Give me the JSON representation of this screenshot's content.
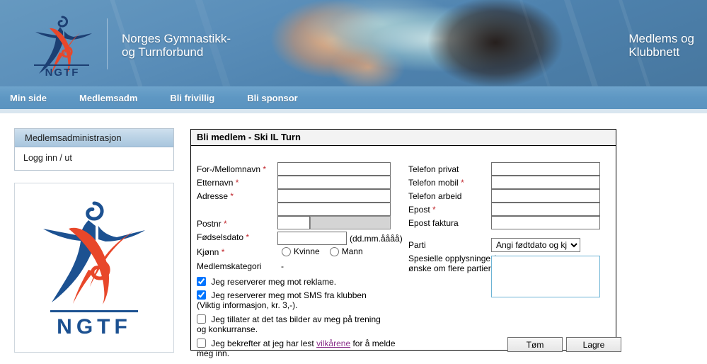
{
  "header": {
    "org_name_line1": "Norges Gymnastikk-",
    "org_name_line2": "og Turnforbund",
    "logo_word": "NGTF",
    "right_line1": "Medlems og",
    "right_line2": "Klubbnett",
    "banner_blue": "#5b8fba"
  },
  "nav": {
    "items": [
      {
        "label": "Min side"
      },
      {
        "label": "Medlemsadm"
      },
      {
        "label": "Bli frivillig"
      },
      {
        "label": "Bli sponsor"
      }
    ],
    "bar_color": "#5e97c3"
  },
  "sidebar": {
    "panel_title": "Medlemsadministrasjon",
    "links": [
      {
        "label": "Logg inn / ut"
      }
    ],
    "logo_word": "NGTF",
    "logo_blue": "#1c5191",
    "logo_red": "#e8472a"
  },
  "form": {
    "title_main": "Bli medlem",
    "title_sep": " - ",
    "title_club": "Ski IL Turn",
    "left_fields": [
      {
        "label": "For-/Mellomnavn",
        "required": true,
        "value": "",
        "placeholder": ""
      },
      {
        "label": "Etternavn",
        "required": true,
        "value": "",
        "placeholder": ""
      },
      {
        "label": "Adresse",
        "required": true,
        "value": "",
        "placeholder": ""
      }
    ],
    "address_line2": {
      "value": "",
      "placeholder": ""
    },
    "postnr": {
      "label": "Postnr",
      "required": true,
      "value": "",
      "city_value": "",
      "city_disabled": true
    },
    "fodselsdato": {
      "label": "Fødselsdato",
      "required": true,
      "value": "",
      "hint": "(dd.mm.åååå)"
    },
    "kjonn": {
      "label": "Kjønn",
      "required": true,
      "options": [
        {
          "label": "Kvinne",
          "checked": false
        },
        {
          "label": "Mann",
          "checked": false
        }
      ]
    },
    "medlemskategori": {
      "label": "Medlemskategori",
      "value": "-"
    },
    "right_fields": [
      {
        "label": "Telefon privat",
        "required": false,
        "value": ""
      },
      {
        "label": "Telefon mobil",
        "required": true,
        "value": ""
      },
      {
        "label": "Telefon arbeid",
        "required": false,
        "value": ""
      },
      {
        "label": "Epost",
        "required": true,
        "value": ""
      },
      {
        "label": "Epost faktura",
        "required": false,
        "value": ""
      }
    ],
    "parti": {
      "label": "Parti",
      "selected": "Angi fødtdato og kjønn",
      "options": [
        "Angi fødtdato og kjønn"
      ]
    },
    "spesielle": {
      "label_line1": "Spesielle opplysninger/",
      "label_line2": "ønske om flere partier",
      "value": "",
      "placeholder": ""
    },
    "checkboxes": [
      {
        "checked": true,
        "text": "Jeg reserverer meg mot reklame.",
        "link_text": null
      },
      {
        "checked": true,
        "text": "Jeg reserverer meg mot SMS fra klubben (Viktig informasjon, kr. 3,-).",
        "link_text": null
      },
      {
        "checked": false,
        "text": "Jeg tillater at det tas bilder av meg på trening og konkurranse.",
        "link_text": null
      },
      {
        "checked": false,
        "text_before": "Jeg bekrefter at jeg har lest ",
        "link_text": "vilkårene",
        "text_after": " for å melde meg inn."
      }
    ]
  },
  "buttons": {
    "clear_label": "Tøm",
    "save_label": "Lagre"
  }
}
